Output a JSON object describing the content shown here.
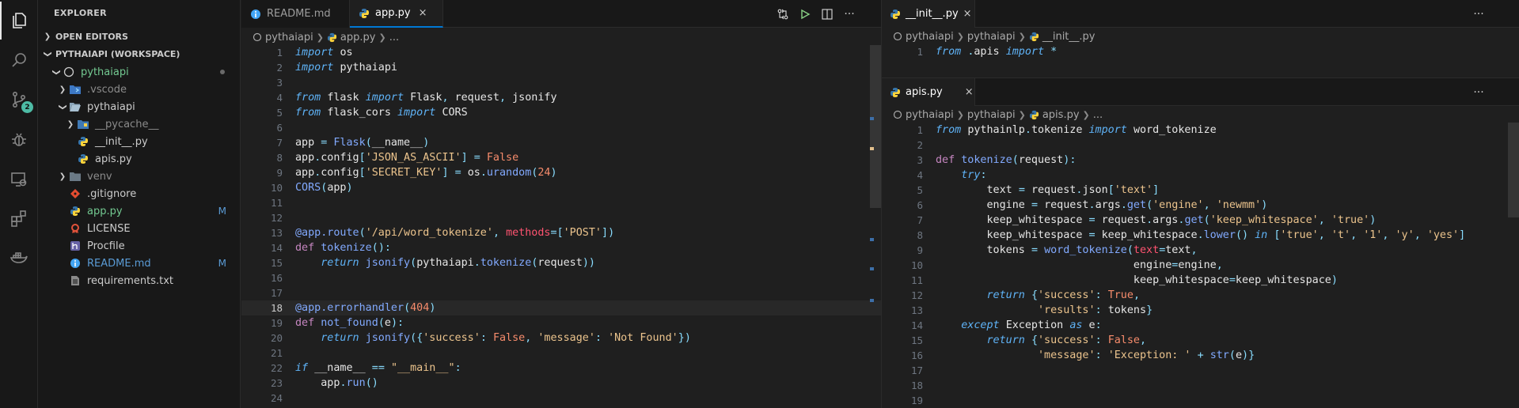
{
  "activity_bar": {
    "items": [
      {
        "name": "explorer-icon"
      },
      {
        "name": "search-icon"
      },
      {
        "name": "source-control-icon",
        "badge": "2"
      },
      {
        "name": "run-debug-icon"
      },
      {
        "name": "remote-explorer-icon"
      },
      {
        "name": "extensions-icon"
      },
      {
        "name": "docker-icon"
      }
    ]
  },
  "sidebar": {
    "title": "EXPLORER",
    "sections": {
      "open_editors": "OPEN EDITORS",
      "workspace": "PYTHAIAPI (WORKSPACE)"
    },
    "tree": [
      {
        "label": "pythaiapi",
        "icon": "folder-root-icon",
        "modified_dot": true
      },
      {
        "label": ".vscode",
        "icon": "folder-vscode-icon"
      },
      {
        "label": "pythaiapi",
        "icon": "folder-open-icon"
      },
      {
        "label": "__pycache__",
        "icon": "folder-pycache-icon"
      },
      {
        "label": "__init__.py",
        "icon": "python-file-icon"
      },
      {
        "label": "apis.py",
        "icon": "python-file-icon"
      },
      {
        "label": "venv",
        "icon": "folder-icon"
      },
      {
        "label": ".gitignore",
        "icon": "git-icon"
      },
      {
        "label": "app.py",
        "icon": "python-file-icon",
        "decoration": "M"
      },
      {
        "label": "LICENSE",
        "icon": "license-icon"
      },
      {
        "label": "Procfile",
        "icon": "heroku-icon"
      },
      {
        "label": "README.md",
        "icon": "info-icon",
        "decoration": "M"
      },
      {
        "label": "requirements.txt",
        "icon": "text-file-icon"
      }
    ]
  },
  "editor_left": {
    "tabs": [
      {
        "label": "README.md",
        "icon": "info-icon",
        "active": false
      },
      {
        "label": "app.py",
        "icon": "python-file-icon",
        "active": true,
        "close": "×"
      }
    ],
    "actions": [
      "compare-changes-icon",
      "run-icon",
      "split-editor-icon",
      "more-actions-icon"
    ],
    "breadcrumb": [
      "pythaiapi",
      "app.py",
      "..."
    ],
    "lines": [
      {
        "n": "1",
        "t": "import os"
      },
      {
        "n": "2",
        "t": "import pythaiapi"
      },
      {
        "n": "3",
        "t": ""
      },
      {
        "n": "4",
        "t": "from flask import Flask, request, jsonify"
      },
      {
        "n": "5",
        "t": "from flask_cors import CORS"
      },
      {
        "n": "6",
        "t": ""
      },
      {
        "n": "7",
        "t": "app = Flask(__name__)"
      },
      {
        "n": "8",
        "t": "app.config['JSON_AS_ASCII'] = False"
      },
      {
        "n": "9",
        "t": "app.config['SECRET_KEY'] = os.urandom(24)"
      },
      {
        "n": "10",
        "t": "CORS(app)"
      },
      {
        "n": "11",
        "t": ""
      },
      {
        "n": "12",
        "t": ""
      },
      {
        "n": "13",
        "t": "@app.route('/api/word_tokenize', methods=['POST'])"
      },
      {
        "n": "14",
        "t": "def tokenize():"
      },
      {
        "n": "15",
        "t": "    return jsonify(pythaiapi.tokenize(request))"
      },
      {
        "n": "16",
        "t": ""
      },
      {
        "n": "17",
        "t": ""
      },
      {
        "n": "18",
        "t": "@app.errorhandler(404)"
      },
      {
        "n": "19",
        "t": "def not_found(e):"
      },
      {
        "n": "20",
        "t": "    return jsonify({'success': False, 'message': 'Not Found'})"
      },
      {
        "n": "21",
        "t": ""
      },
      {
        "n": "22",
        "t": "if __name__ == \"__main__\":"
      },
      {
        "n": "23",
        "t": "    app.run()"
      },
      {
        "n": "24",
        "t": ""
      }
    ]
  },
  "editor_right_top": {
    "tab": {
      "label": "__init__.py",
      "close": "×"
    },
    "more": "···",
    "breadcrumb": [
      "pythaiapi",
      "pythaiapi",
      "__init__.py"
    ],
    "lines": [
      {
        "n": "1",
        "t": "from .apis import *"
      }
    ]
  },
  "editor_right_bottom": {
    "tab": {
      "label": "apis.py",
      "close": "×"
    },
    "more": "···",
    "breadcrumb": [
      "pythaiapi",
      "pythaiapi",
      "apis.py",
      "..."
    ],
    "lines": [
      {
        "n": "1",
        "t": "from pythainlp.tokenize import word_tokenize"
      },
      {
        "n": "2",
        "t": ""
      },
      {
        "n": "3",
        "t": "def tokenize(request):"
      },
      {
        "n": "4",
        "t": "    try:"
      },
      {
        "n": "5",
        "t": "        text = request.json['text']"
      },
      {
        "n": "6",
        "t": "        engine = request.args.get('engine', 'newmm')"
      },
      {
        "n": "7",
        "t": "        keep_whitespace = request.args.get('keep_whitespace', 'true')"
      },
      {
        "n": "8",
        "t": "        keep_whitespace = keep_whitespace.lower() in ['true', 't', '1', 'y', 'yes']"
      },
      {
        "n": "9",
        "t": "        tokens = word_tokenize(text=text,"
      },
      {
        "n": "10",
        "t": "                               engine=engine,"
      },
      {
        "n": "11",
        "t": "                               keep_whitespace=keep_whitespace)"
      },
      {
        "n": "12",
        "t": "        return {'success': True,"
      },
      {
        "n": "13",
        "t": "                'results': tokens}"
      },
      {
        "n": "14",
        "t": "    except Exception as e:"
      },
      {
        "n": "15",
        "t": "        return {'success': False,"
      },
      {
        "n": "16",
        "t": "                'message': 'Exception: ' + str(e)}"
      },
      {
        "n": "17",
        "t": ""
      },
      {
        "n": "18",
        "t": ""
      },
      {
        "n": "19",
        "t": ""
      }
    ]
  },
  "colors": {
    "accent": "#0078d4",
    "badge": "#4dbba5",
    "modified": "#73c991",
    "keyword": "#5fb3f7",
    "string": "#ecc48d",
    "number": "#f78c6c",
    "function": "#82aaff",
    "parameter": "#ff5370"
  }
}
